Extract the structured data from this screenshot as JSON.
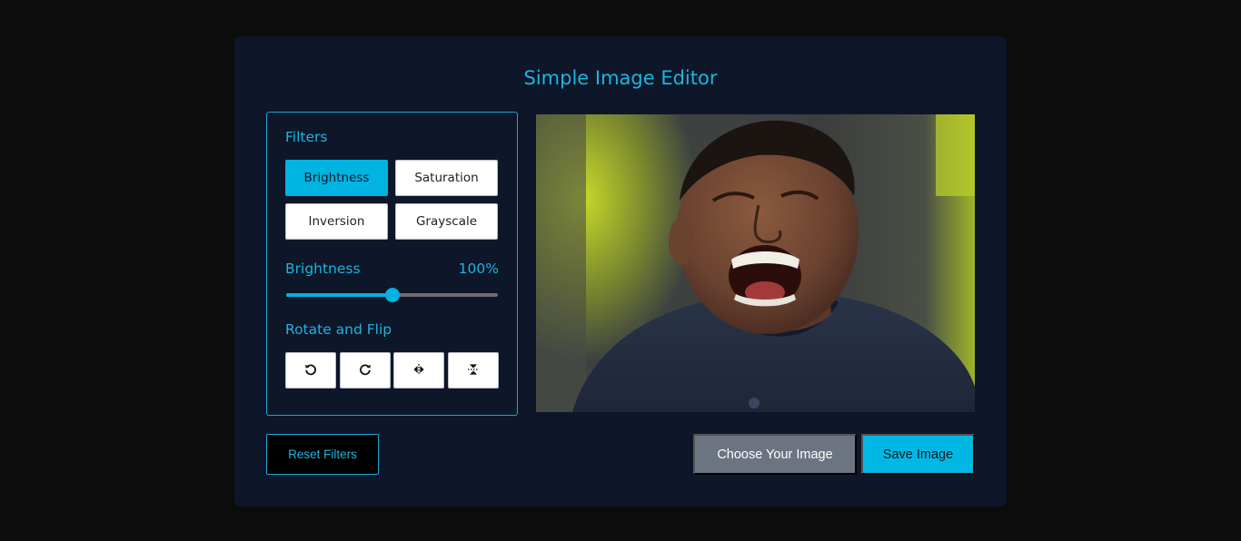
{
  "app": {
    "title": "Simple Image Editor"
  },
  "filters": {
    "heading": "Filters",
    "options": [
      "Brightness",
      "Saturation",
      "Inversion",
      "Grayscale"
    ],
    "active": "Brightness",
    "current": {
      "name": "Brightness",
      "value_label": "100%",
      "value": 100,
      "min": 0,
      "max": 200
    }
  },
  "rotate_flip": {
    "heading": "Rotate and Flip",
    "buttons": [
      "rotate-left-icon",
      "rotate-right-icon",
      "flip-horizontal-icon",
      "flip-vertical-icon"
    ]
  },
  "actions": {
    "reset": "Reset Filters",
    "choose": "Choose Your Image",
    "save": "Save Image"
  },
  "colors": {
    "accent": "#00b3e0",
    "card_bg": "#0e1629",
    "page_bg": "#0c0c0c",
    "choose_bg": "#6b7480"
  }
}
